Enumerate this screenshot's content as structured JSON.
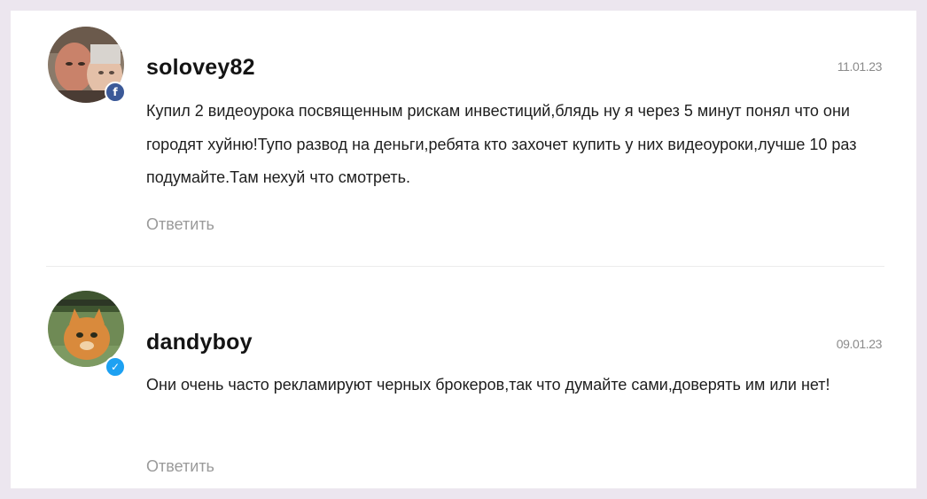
{
  "comments": [
    {
      "username": "solovey82",
      "date": "11.01.23",
      "text": "Купил 2 видеоурока посвященным рискам инвестиций,блядь ну я через 5 минут понял что они городят хуйню!Тупо развод на деньги,ребята кто захочет купить у них видеоуроки,лучше 10 раз подумайте.Там нехуй что смотреть.",
      "reply_label": "Ответить",
      "social": "facebook",
      "social_glyph": "f"
    },
    {
      "username": "dandyboy",
      "date": "09.01.23",
      "text": "Они очень часто рекламируют черных брокеров,так что думайте сами,доверять им или нет!",
      "reply_label": "Ответить",
      "social": "twitter",
      "social_glyph": "✓"
    }
  ],
  "colors": {
    "page_bg": "#ece6ef",
    "card_bg": "#ffffff",
    "facebook": "#3b5998",
    "twitter": "#1da1f2",
    "reply": "#9a9a9a"
  },
  "icons": [
    "facebook-icon",
    "twitter-icon"
  ]
}
